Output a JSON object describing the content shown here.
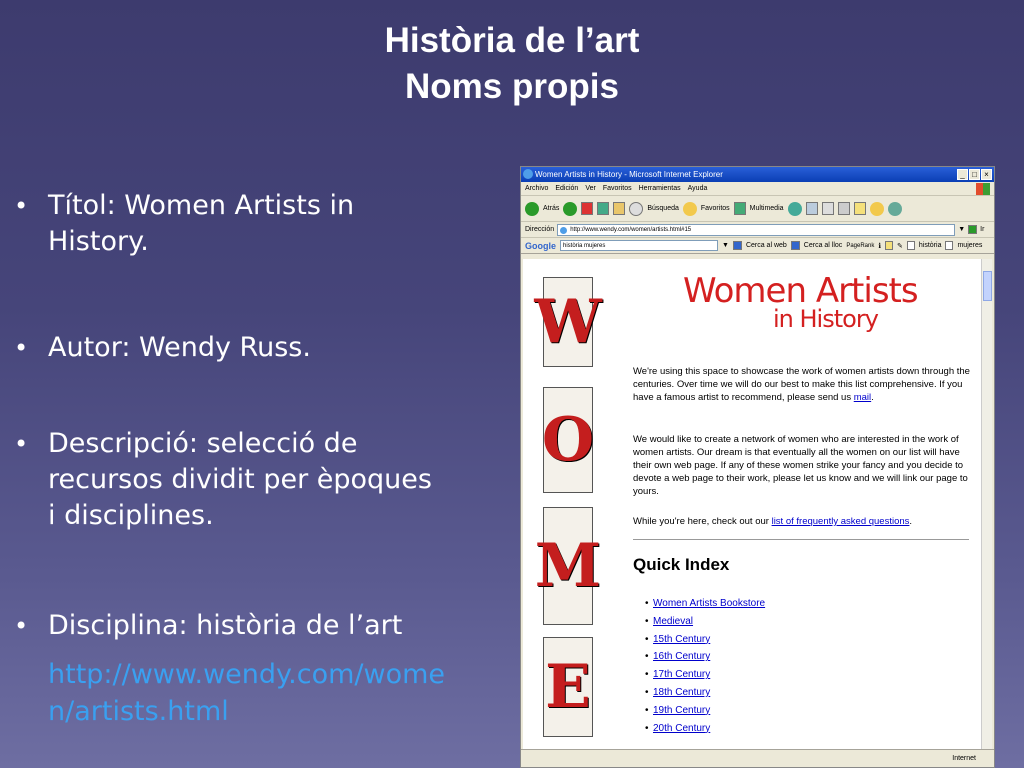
{
  "slide": {
    "title_line1": "Història de l’art",
    "title_line2": "Noms propis",
    "bullets": [
      "Títol: Women Artists in History.",
      "Autor: Wendy Russ.",
      "Descripció: selecció de recursos dividit per èpoques i disciplines.",
      "Disciplina: història de l’art"
    ],
    "url": "http://www.wendy.com/women/artists.html"
  },
  "browser": {
    "window_title": "Women Artists in History - Microsoft Internet Explorer",
    "menu": [
      "Archivo",
      "Edición",
      "Ver",
      "Favoritos",
      "Herramientas",
      "Ayuda"
    ],
    "toolbar": {
      "back": "Atrás",
      "search": "Búsqueda",
      "favorites": "Favoritos",
      "multimedia": "Multimedia"
    },
    "address_label": "Dirección",
    "address_value": "http://www.wendy.com/women/artists.html#15",
    "go_label": "Ir",
    "google": {
      "logo": "Google",
      "query": "història mujeres",
      "web_search": "Cerca al web",
      "site_search": "Cerca al lloc",
      "pagerank": "PageRank",
      "tag1": "història",
      "tag2": "mujeres"
    },
    "status_zone": "Internet"
  },
  "page": {
    "title": "Women Artists",
    "subtitle": "in History",
    "letters": [
      "W",
      "O",
      "M",
      "E"
    ],
    "para1_text": "We're using this space to showcase the work of women artists down through the centuries. Over time we will do our best to make this list comprehensive. If you have a famous artist to recommend, please send us ",
    "para1_link": "mail",
    "para1_end": ".",
    "para2": "We would like to create a network of women who are interested in the work of women artists. Our dream is that eventually all the women on our list will have their own web page. If any of these women strike your fancy and you decide to devote a web page to their work, please let us know and we will link our page to yours.",
    "para3_text": "While you're here, check out our ",
    "para3_link": "list of frequently asked questions",
    "para3_end": ".",
    "quick_index_title": "Quick Index",
    "quick_index": [
      "Women Artists Bookstore",
      "Medieval",
      "15th Century",
      "16th Century",
      "17th Century",
      "18th Century",
      "19th Century",
      "20th Century"
    ]
  }
}
